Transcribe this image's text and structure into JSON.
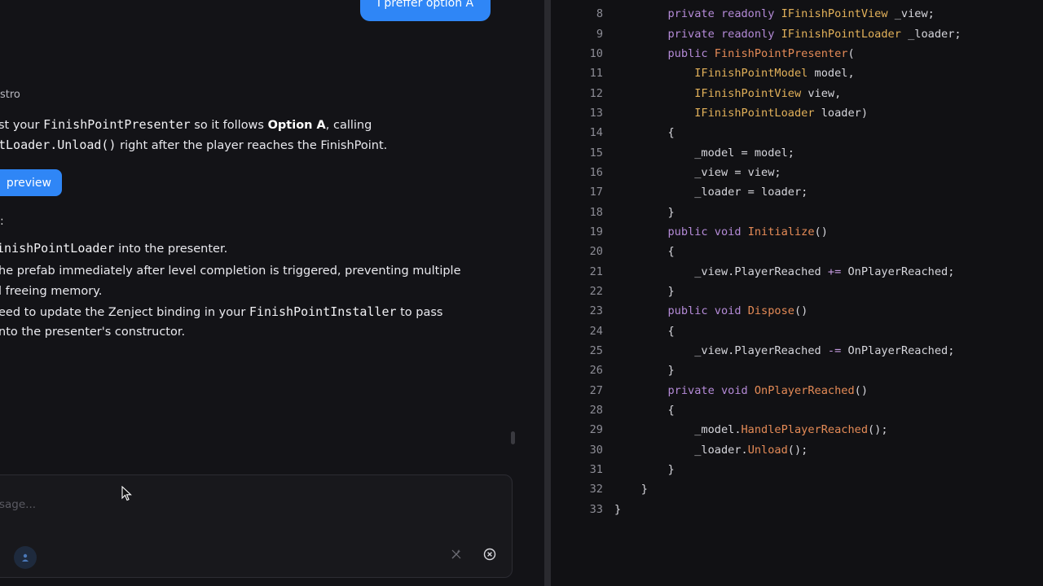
{
  "chat": {
    "user_message": "I preffer option A",
    "sender_label": "stro",
    "reply": {
      "line1": {
        "a": "st your ",
        "code": "FinishPointPresenter",
        "b": " so it follows ",
        "bold": "Option A",
        "c": ", calling"
      },
      "line2": {
        "code": "tLoader.Unload()",
        "b": " right after the player reaches the FinishPoint."
      },
      "preview_button": "preview",
      "colon": ":",
      "line3": {
        "code": "inishPointLoader",
        "b": " into the presenter."
      },
      "line4": "he prefab immediately after level completion is triggered, preventing multiple",
      "line5": "l freeing memory.",
      "line6": {
        "a": "eed to update the Zenject binding in your ",
        "code": "FinishPointInstaller",
        "b": " to pass"
      },
      "line7": "nto the presenter's constructor."
    },
    "composer": {
      "placeholder": "sage..."
    }
  },
  "icons": {
    "attach": "person-icon",
    "magic": "magic-wand-icon",
    "stop": "close-circle-icon",
    "cursor": "mouse-pointer-icon"
  },
  "colors": {
    "accent": "#2f86f6",
    "keyword": "#b58bd8",
    "type": "#e2b15a",
    "method": "#e58b57"
  },
  "code": {
    "lines": [
      {
        "n": "8",
        "tokens": [
          [
            "kw",
            "        private readonly "
          ],
          [
            "ty",
            "IFinishPointView"
          ],
          [
            "pl",
            " _view;"
          ]
        ]
      },
      {
        "n": "9",
        "tokens": [
          [
            "kw",
            "        private readonly "
          ],
          [
            "ty",
            "IFinishPointLoader"
          ],
          [
            "pl",
            " _loader;"
          ]
        ]
      },
      {
        "n": "10",
        "tokens": [
          [
            "kw",
            "        public "
          ],
          [
            "fn",
            "FinishPointPresenter"
          ],
          [
            "pl",
            "("
          ]
        ]
      },
      {
        "n": "11",
        "tokens": [
          [
            "pl",
            "            "
          ],
          [
            "ty",
            "IFinishPointModel"
          ],
          [
            "pl",
            " model,"
          ]
        ]
      },
      {
        "n": "12",
        "tokens": [
          [
            "pl",
            "            "
          ],
          [
            "ty",
            "IFinishPointView"
          ],
          [
            "pl",
            " view,"
          ]
        ]
      },
      {
        "n": "13",
        "tokens": [
          [
            "pl",
            "            "
          ],
          [
            "ty",
            "IFinishPointLoader"
          ],
          [
            "pl",
            " loader)"
          ]
        ]
      },
      {
        "n": "14",
        "tokens": [
          [
            "pl",
            "        {"
          ]
        ]
      },
      {
        "n": "15",
        "tokens": [
          [
            "pl",
            "            _model = model;"
          ]
        ]
      },
      {
        "n": "16",
        "tokens": [
          [
            "pl",
            "            _view = view;"
          ]
        ]
      },
      {
        "n": "17",
        "tokens": [
          [
            "pl",
            "            _loader = loader;"
          ]
        ]
      },
      {
        "n": "18",
        "tokens": [
          [
            "pl",
            "        }"
          ]
        ]
      },
      {
        "n": "19",
        "tokens": [
          [
            "kw",
            "        public void "
          ],
          [
            "fn",
            "Initialize"
          ],
          [
            "pl",
            "()"
          ]
        ]
      },
      {
        "n": "20",
        "tokens": [
          [
            "pl",
            "        {"
          ]
        ]
      },
      {
        "n": "21",
        "tokens": [
          [
            "pl",
            "            _view.PlayerReached "
          ],
          [
            "op",
            "+="
          ],
          [
            "pl",
            " OnPlayerReached;"
          ]
        ]
      },
      {
        "n": "22",
        "tokens": [
          [
            "pl",
            "        }"
          ]
        ]
      },
      {
        "n": "23",
        "tokens": [
          [
            "kw",
            "        public void "
          ],
          [
            "fn",
            "Dispose"
          ],
          [
            "pl",
            "()"
          ]
        ]
      },
      {
        "n": "24",
        "tokens": [
          [
            "pl",
            "        {"
          ]
        ]
      },
      {
        "n": "25",
        "tokens": [
          [
            "pl",
            "            _view.PlayerReached "
          ],
          [
            "op",
            "-="
          ],
          [
            "pl",
            " OnPlayerReached;"
          ]
        ]
      },
      {
        "n": "26",
        "tokens": [
          [
            "pl",
            "        }"
          ]
        ]
      },
      {
        "n": "27",
        "tokens": [
          [
            "kw",
            "        private void "
          ],
          [
            "fn",
            "OnPlayerReached"
          ],
          [
            "pl",
            "()"
          ]
        ]
      },
      {
        "n": "28",
        "tokens": [
          [
            "pl",
            "        {"
          ]
        ]
      },
      {
        "n": "29",
        "tokens": [
          [
            "pl",
            "            _model."
          ],
          [
            "fn",
            "HandlePlayerReached"
          ],
          [
            "pl",
            "();"
          ]
        ]
      },
      {
        "n": "30",
        "tokens": [
          [
            "pl",
            "            _loader."
          ],
          [
            "fn",
            "Unload"
          ],
          [
            "pl",
            "();"
          ]
        ]
      },
      {
        "n": "31",
        "tokens": [
          [
            "pl",
            "        }"
          ]
        ]
      },
      {
        "n": "32",
        "tokens": [
          [
            "pl",
            "    }"
          ]
        ]
      },
      {
        "n": "33",
        "tokens": [
          [
            "pl",
            "}"
          ]
        ]
      }
    ]
  }
}
